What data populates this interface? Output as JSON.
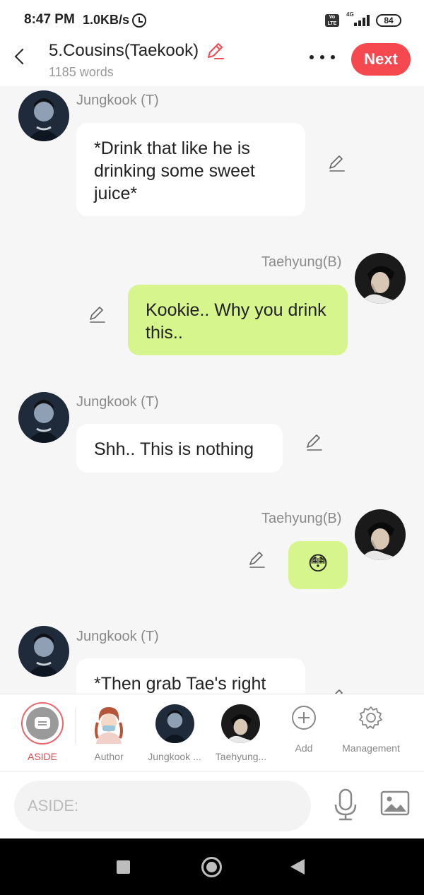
{
  "status_bar": {
    "time": "8:47 PM",
    "speed": "1.0KB/s",
    "network": "4G",
    "volte": "Vo LTE",
    "battery": "84"
  },
  "header": {
    "title": "5.Cousins(Taekook)",
    "word_count": "1185 words",
    "next_label": "Next"
  },
  "messages": [
    {
      "speaker": "Jungkook (T)",
      "side": "left",
      "text": "*Drink that like he is drinking some sweet juice*"
    },
    {
      "speaker": "Taehyung(B)",
      "side": "right",
      "text": "Kookie.. Why you drink this.."
    },
    {
      "speaker": "Jungkook (T)",
      "side": "left",
      "text": "Shh.. This is nothing"
    },
    {
      "speaker": "Taehyung(B)",
      "side": "right",
      "text": "😳"
    },
    {
      "speaker": "Jungkook (T)",
      "side": "left",
      "text": "*Then grab Tae's right"
    }
  ],
  "toolbar": {
    "aside": "ASIDE",
    "author": "Author",
    "jungkook": "Jungkook ...",
    "taehyung": "Taehyung...",
    "add": "Add",
    "management": "Management"
  },
  "input": {
    "placeholder": "ASIDE:"
  },
  "colors": {
    "accent": "#f5484f",
    "right_bubble": "#d6f58c",
    "aside_active": "#e8676b"
  }
}
